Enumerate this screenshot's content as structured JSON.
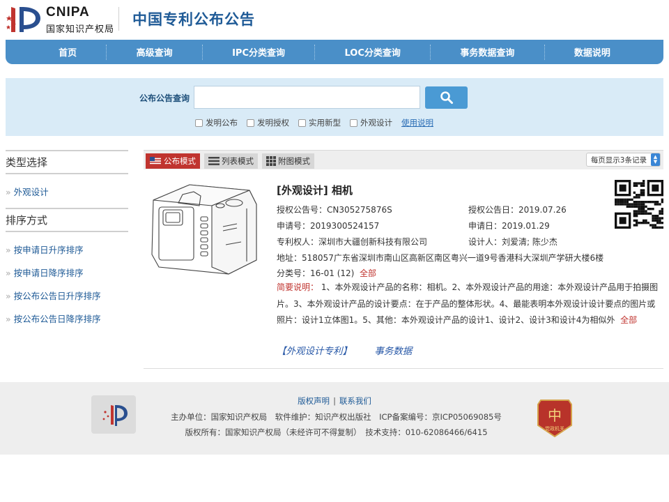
{
  "header": {
    "logo_en": "CNIPA",
    "logo_cn": "国家知识产权局",
    "site_title": "中国专利公布公告"
  },
  "nav": {
    "items": [
      "首页",
      "高级查询",
      "IPC分类查询",
      "LOC分类查询",
      "事务数据查询",
      "数据说明"
    ]
  },
  "search": {
    "label": "公布公告查询",
    "value": "",
    "placeholder": "",
    "checkboxes": [
      "发明公布",
      "发明授权",
      "实用新型",
      "外观设计"
    ],
    "help_link": "使用说明"
  },
  "sidebar": {
    "type_head": "类型选择",
    "type_items": [
      "外观设计"
    ],
    "sort_head": "排序方式",
    "sort_items": [
      "按申请日升序排序",
      "按申请日降序排序",
      "按公布公告日升序排序",
      "按公布公告日降序排序"
    ]
  },
  "toolbar": {
    "modes": [
      "公布模式",
      "列表模式",
      "附图模式"
    ],
    "per_page": "每页显示3条记录"
  },
  "result": {
    "title": "[外观设计] 相机",
    "grant_no_label": "授权公告号：",
    "grant_no": "CN305275876S",
    "grant_date_label": "授权公告日：",
    "grant_date": "2019.07.26",
    "app_no_label": "申请号：",
    "app_no": "2019300524157",
    "app_date_label": "申请日：",
    "app_date": "2019.01.29",
    "patentee_label": "专利权人：",
    "patentee": "深圳市大疆创新科技有限公司",
    "designer_label": "设计人：",
    "designer": "刘爱清; 陈少杰",
    "address_label": "地址：",
    "address": "518057广东省深圳市南山区高新区南区粤兴一道9号香港科大深圳产学研大楼6楼",
    "class_label": "分类号：",
    "class_value": "16-01 (12)",
    "class_more": "全部",
    "summary_label": "简要说明：",
    "summary_text": "1、本外观设计产品的名称：相机。2、本外观设计产品的用途：本外观设计产品用于拍摄图片。3、本外观设计产品的设计要点：在于产品的整体形状。4、最能表明本外观设计设计要点的图片或照片：设计1立体图1。5、其他：本外观设计产品的设计1、设计2、设计3和设计4为相似外",
    "summary_more": "全部",
    "link_patent": "【外观设计专利】",
    "link_events": "事务数据"
  },
  "footer": {
    "link_copyright": "版权声明",
    "link_sep": "|",
    "link_contact": "联系我们",
    "line1": "主办单位：国家知识产权局　软件维护：知识产权出版社　ICP备案编号：京ICP05069085号",
    "line2": "版权所有：国家知识产权局（未经许可不得复制）　技术支持：010-62086466/6415",
    "badge_text": "党政机关"
  },
  "colors": {
    "nav_bg": "#4a8fc8",
    "title_blue": "#1e5a96",
    "accent_red": "#c0342f",
    "search_band": "#d9ebf7"
  }
}
